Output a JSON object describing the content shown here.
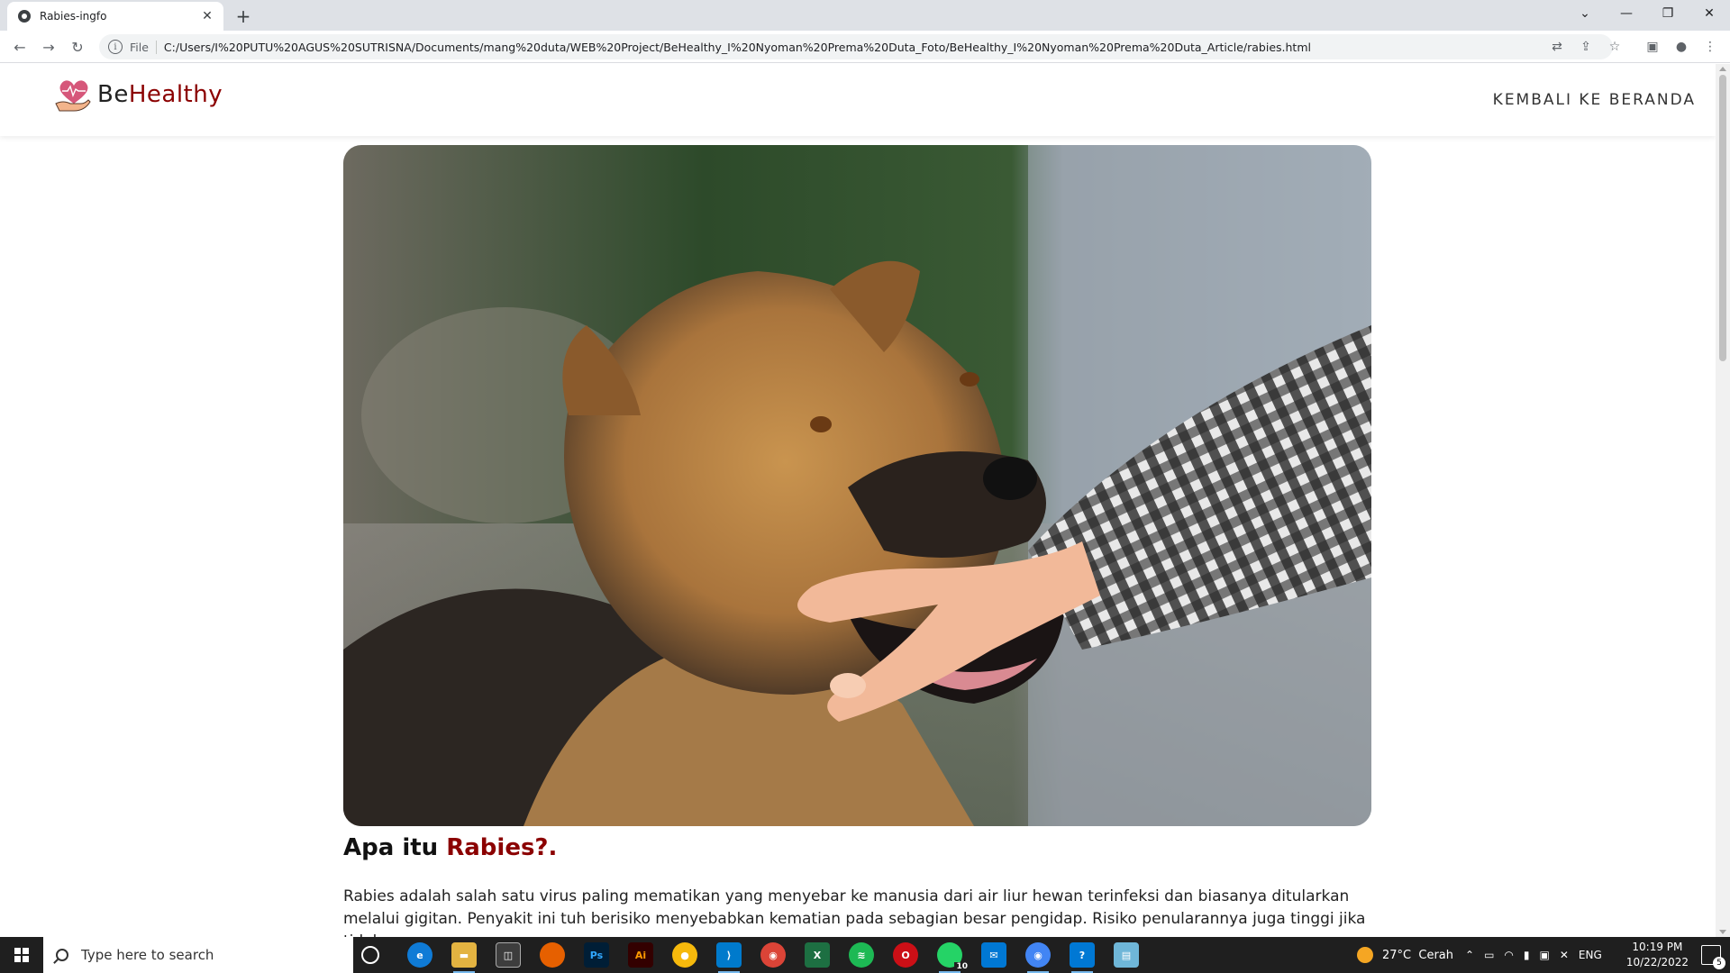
{
  "browser": {
    "tab_title": "Rabies-ingfo",
    "url_scheme": "File",
    "url": "C:/Users/I%20PUTU%20AGUS%20SUTRISNA/Documents/mang%20duta/WEB%20Project/BeHealthy_I%20Nyoman%20Prema%20Duta_Foto/BeHealthy_I%20Nyoman%20Prema%20Duta_Article/rabies.html"
  },
  "site": {
    "brand_prefix": "Be",
    "brand_suffix": "Healthy",
    "back_link": "KEMBALI KE BERANDA",
    "accent_color": "#8b0000"
  },
  "article": {
    "title_prefix": "Apa itu ",
    "title_accent": "Rabies?.",
    "body": "Rabies adalah salah satu virus paling mematikan yang menyebar ke manusia dari air liur hewan terinfeksi dan biasanya ditularkan melalui gigitan. Penyakit ini tuh berisiko menyebabkan kematian pada sebagian besar pengidap. Risiko penularannya juga tinggi jika tidak segera"
  },
  "taskbar": {
    "search_placeholder": "Type here to search",
    "weather": "27°C  Cerah",
    "language": "ENG",
    "time": "10:19 PM",
    "date": "10/22/2022",
    "whatsapp_badge": "10",
    "notification_count": "5"
  }
}
